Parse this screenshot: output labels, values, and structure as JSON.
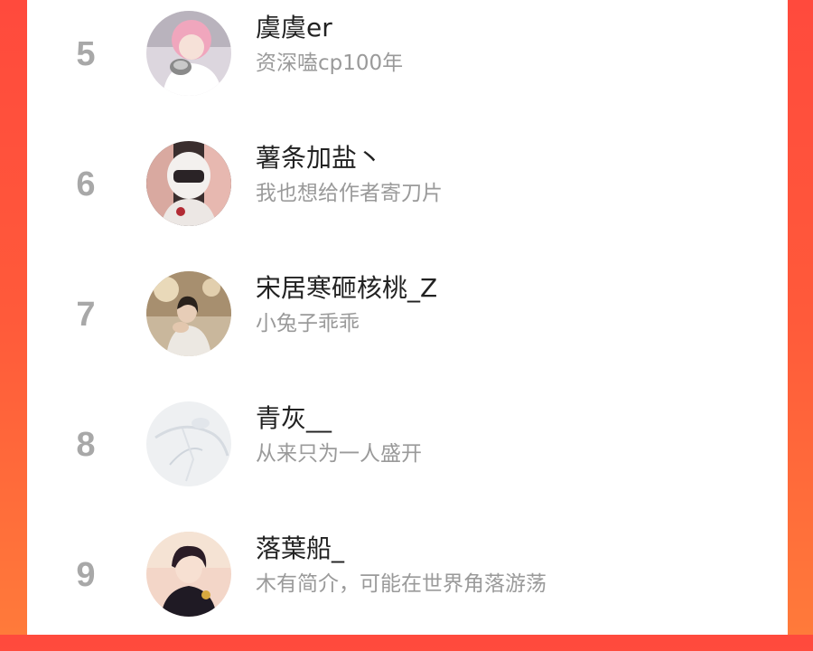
{
  "theme": {
    "accent": "#ff4a3d",
    "rank_color": "#a8a8a8",
    "name_color": "#222222",
    "desc_color": "#9a9a9a"
  },
  "ranking": {
    "items": [
      {
        "rank": "5",
        "name": "虞虞er",
        "desc": "资深嗑cp100年"
      },
      {
        "rank": "6",
        "name": "薯条加盐丶",
        "desc": "我也想给作者寄刀片"
      },
      {
        "rank": "7",
        "name": "宋居寒砸核桃_Z",
        "desc": "小兔子乖乖"
      },
      {
        "rank": "8",
        "name": "青灰__",
        "desc": "从来只为一人盛开"
      },
      {
        "rank": "9",
        "name": "落葉船_",
        "desc": "木有简介，可能在世界角落游荡"
      }
    ]
  }
}
